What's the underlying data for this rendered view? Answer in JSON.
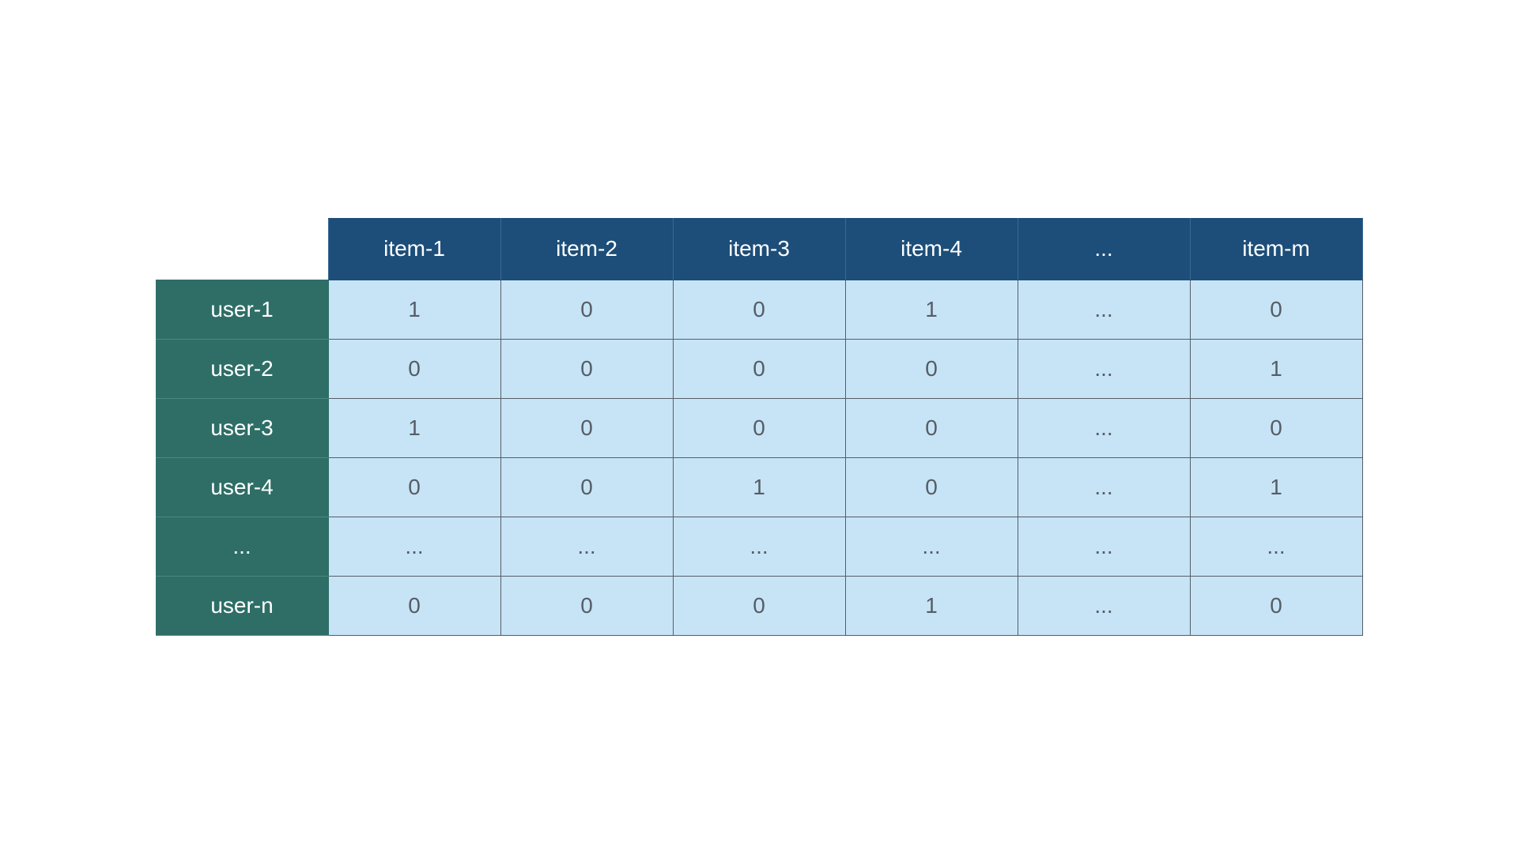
{
  "matrix": {
    "col_headers": [
      "item-1",
      "item-2",
      "item-3",
      "item-4",
      "...",
      "item-m"
    ],
    "row_headers": [
      "user-1",
      "user-2",
      "user-3",
      "user-4",
      "...",
      "user-n"
    ],
    "cells": [
      [
        "1",
        "0",
        "0",
        "1",
        "...",
        "0"
      ],
      [
        "0",
        "0",
        "0",
        "0",
        "...",
        "1"
      ],
      [
        "1",
        "0",
        "0",
        "0",
        "...",
        "0"
      ],
      [
        "0",
        "0",
        "1",
        "0",
        "...",
        "1"
      ],
      [
        "...",
        "...",
        "...",
        "...",
        "...",
        "..."
      ],
      [
        "0",
        "0",
        "0",
        "1",
        "...",
        "0"
      ]
    ]
  },
  "colors": {
    "col_header_bg": "#1d4e79",
    "row_header_bg": "#2e6e66",
    "cell_bg": "#c7e4f6",
    "cell_text": "#555d66"
  }
}
